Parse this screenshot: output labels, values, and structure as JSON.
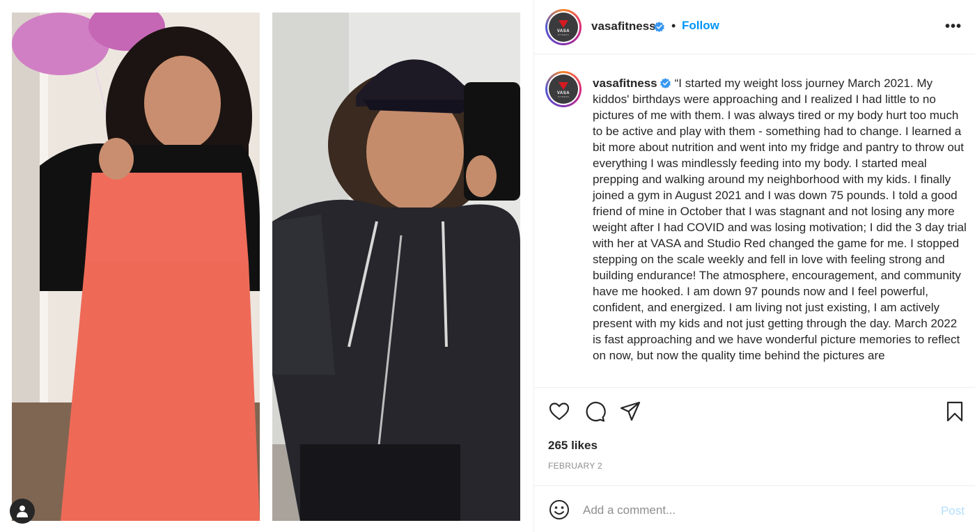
{
  "post": {
    "username": "vasafitness",
    "follow_label": "Follow",
    "separator": "•",
    "more_label": "•••",
    "avatar_text": "VASA",
    "avatar_subtext": "FITNESS",
    "caption": "“I started my weight loss journey March 2021. My kiddos' birthdays were approaching and I realized I had little to no pictures of me with them. I was always tired or my body hurt too much to be active and play with them - something had to change. I learned a bit more about nutrition and went into my fridge and pantry to throw out everything I was mindlessly feeding into my body. I started meal prepping and walking around my neighborhood with my kids. I finally joined a gym in August 2021 and I was down 75 pounds. I told a good friend of mine in October that I was stagnant and not losing any more weight after I had COVID and was losing motivation; I did the 3 day trial with her at VASA and Studio Red changed the game for me. I stopped stepping on the scale weekly and fell in love with feeling strong and building endurance! The atmosphere, encouragement, and community have me hooked. I am down 97 pounds now and I feel powerful, confident, and energized. I am living not just existing, I am actively present with my kids and not just getting through the day. March 2022 is fast approaching and we have wonderful picture memories to reflect on now, but now the quality time behind the pictures are",
    "likes": "265 likes",
    "date": "FEBRUARY 2"
  },
  "comment": {
    "placeholder": "Add a comment...",
    "post_label": "Post"
  },
  "icons": {
    "verified": "verified-badge-icon",
    "like": "heart-icon",
    "comment": "comment-bubble-icon",
    "share": "paper-plane-icon",
    "save": "bookmark-icon",
    "emoji": "smiley-icon",
    "user_tag": "person-icon"
  },
  "colors": {
    "accent": "#0095f6",
    "verified": "#3897f0",
    "post_disabled": "#b2dffc",
    "muted": "#8e8e8e",
    "text": "#262626"
  }
}
